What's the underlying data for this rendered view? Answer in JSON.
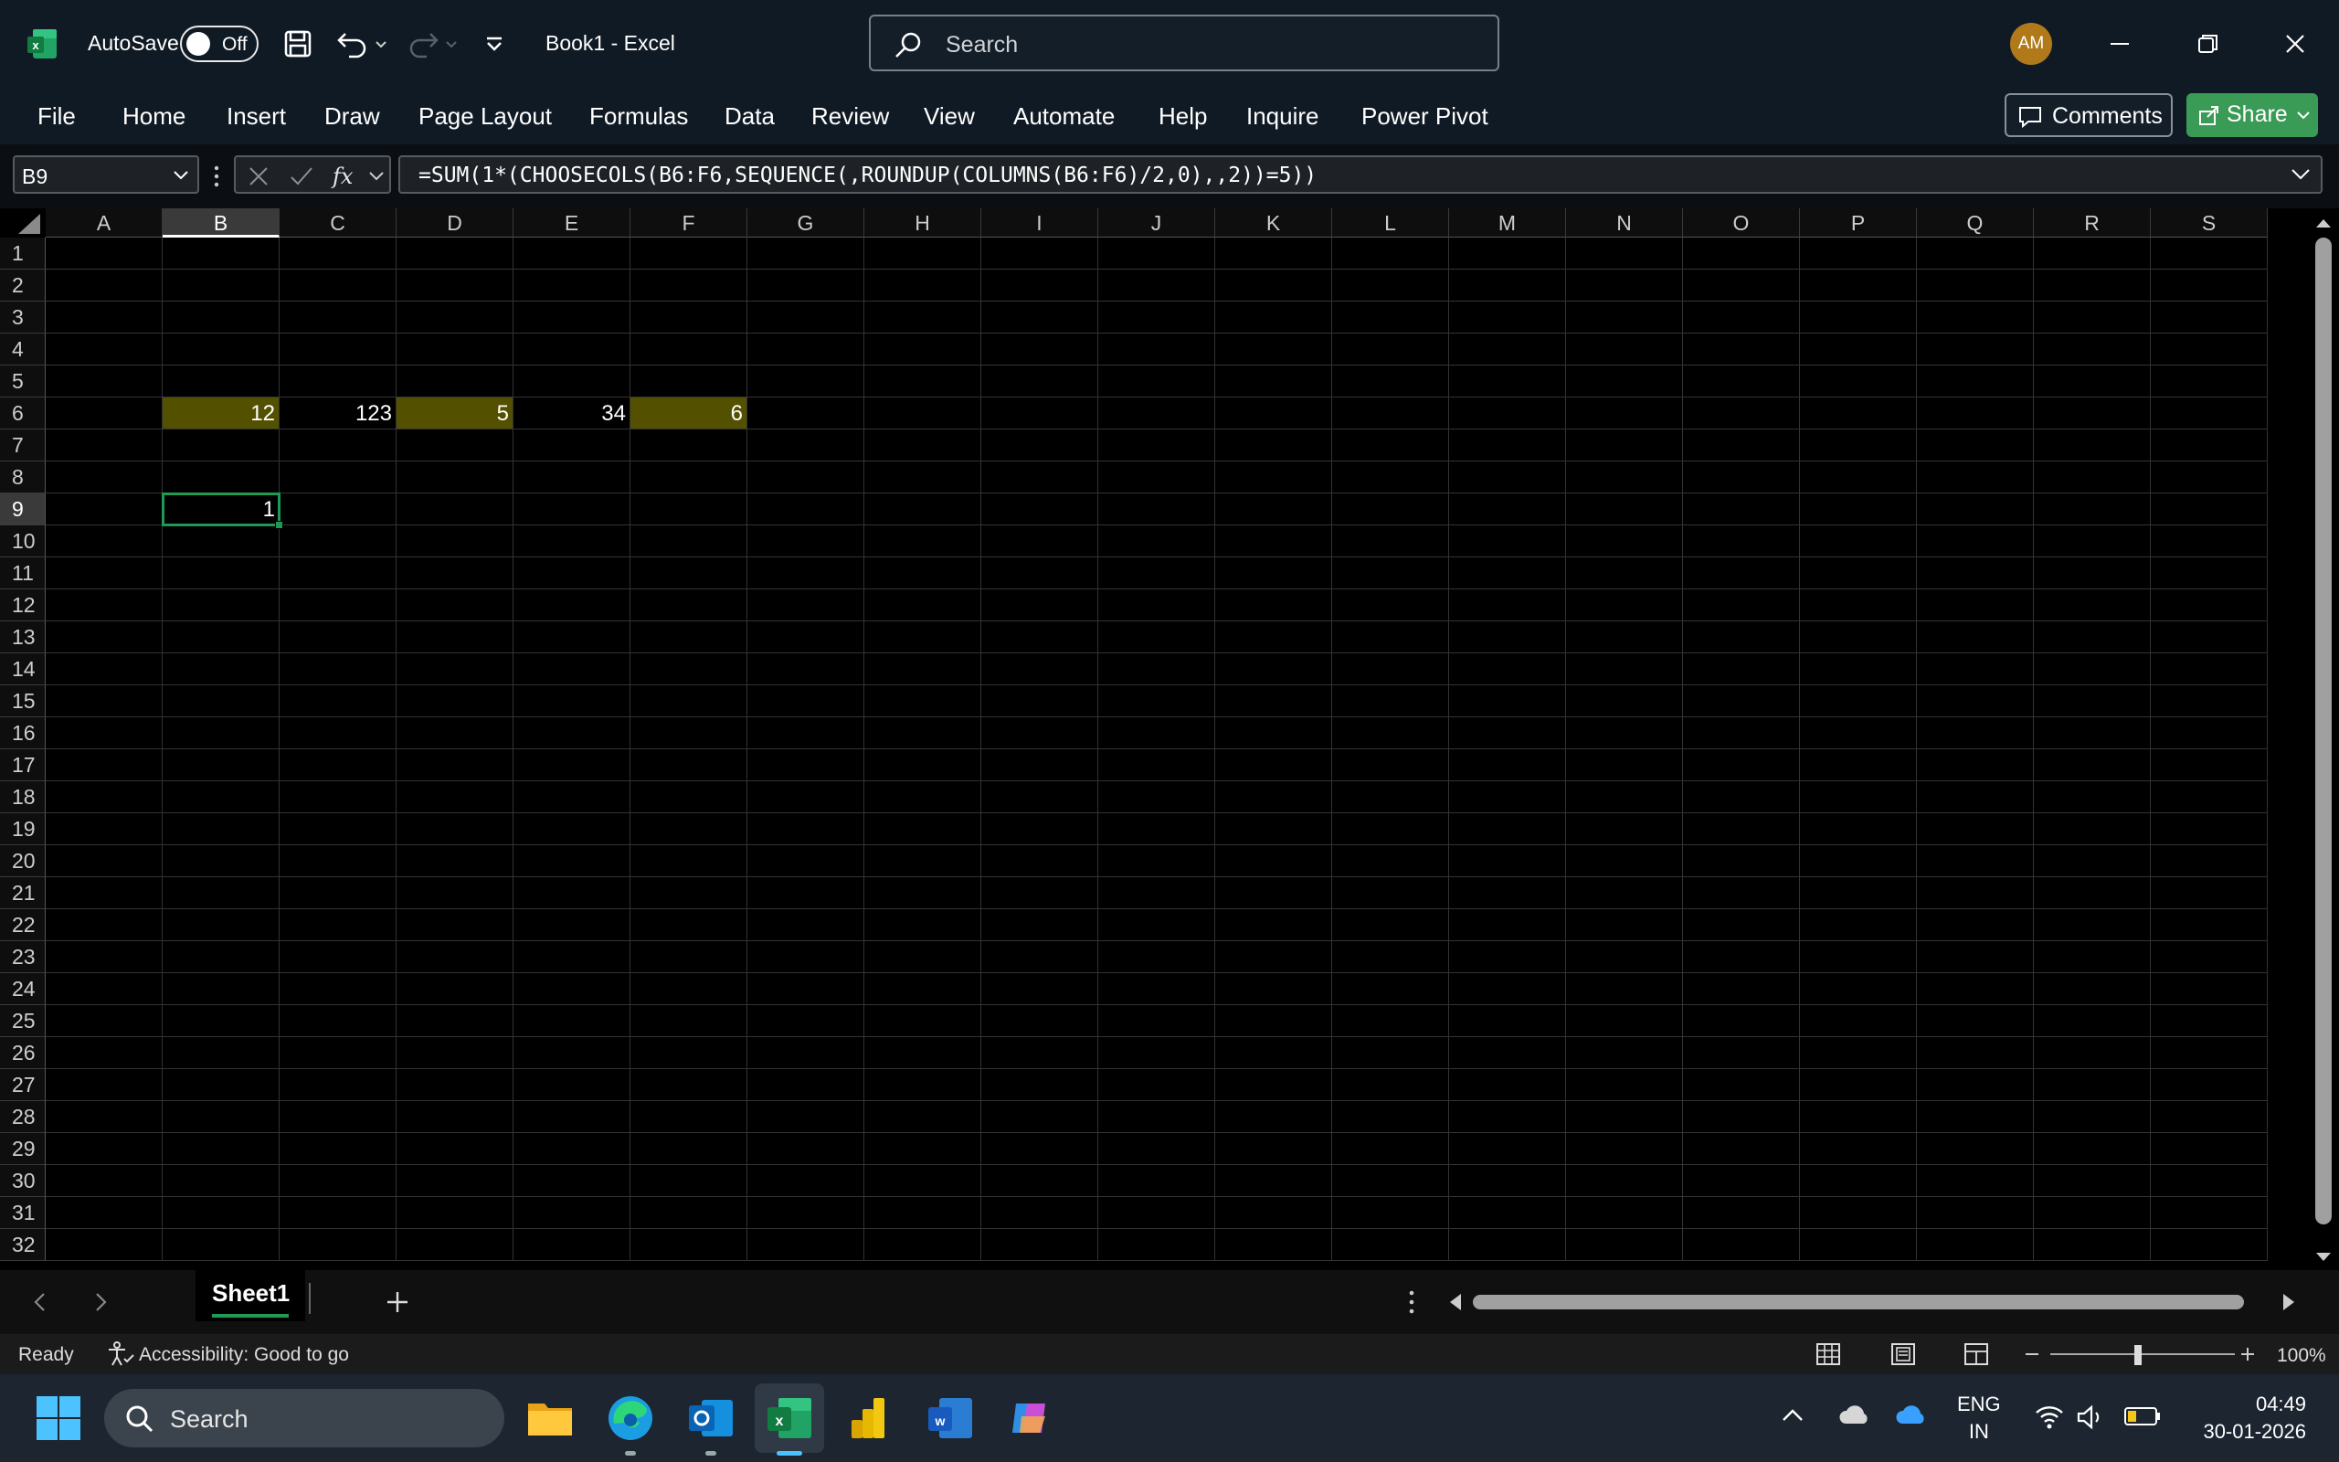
{
  "titlebar": {
    "autosave_label": "AutoSave",
    "autosave_state": "Off",
    "doc_title": "Book1  -  Excel",
    "search_placeholder": "Search",
    "user_initials": "AM"
  },
  "menu": [
    "File",
    "Home",
    "Insert",
    "Draw",
    "Page Layout",
    "Formulas",
    "Data",
    "Review",
    "View",
    "Automate",
    "Help",
    "Inquire",
    "Power Pivot"
  ],
  "buttons": {
    "comments": "Comments",
    "share": "Share"
  },
  "formula_bar": {
    "name_box": "B9",
    "formula": "=SUM(1*(CHOOSECOLS(B6:F6,SEQUENCE(,ROUNDUP(COLUMNS(B6:F6)/2,0),,2))=5))"
  },
  "grid": {
    "columns": [
      "A",
      "B",
      "C",
      "D",
      "E",
      "F",
      "G",
      "H",
      "I",
      "J",
      "K",
      "L",
      "M",
      "N",
      "O",
      "P",
      "Q",
      "R",
      "S"
    ],
    "rows": [
      "1",
      "2",
      "3",
      "4",
      "5",
      "6",
      "7",
      "8",
      "9",
      "10",
      "11",
      "12",
      "13",
      "14",
      "15",
      "16",
      "17",
      "18",
      "19",
      "20",
      "21",
      "22",
      "23",
      "24",
      "25",
      "26",
      "27",
      "28",
      "29",
      "30",
      "31",
      "32"
    ],
    "selected_column": "B",
    "selected_row": "9",
    "cells": {
      "B6": {
        "value": "12",
        "highlight": true
      },
      "C6": {
        "value": "123",
        "highlight": false
      },
      "D6": {
        "value": "5",
        "highlight": true
      },
      "E6": {
        "value": "34",
        "highlight": false
      },
      "F6": {
        "value": "6",
        "highlight": true
      },
      "B9": {
        "value": "1",
        "highlight": false
      }
    },
    "highlight_color": "#535100",
    "active_border_color": "#1f9a55"
  },
  "sheets": {
    "active": "Sheet1"
  },
  "status": {
    "ready": "Ready",
    "accessibility": "Accessibility: Good to go",
    "zoom": "100%"
  },
  "taskbar": {
    "search_placeholder": "Search",
    "lang_line1": "ENG",
    "lang_line2": "IN",
    "time": "04:49",
    "date": "30-01-2026"
  }
}
